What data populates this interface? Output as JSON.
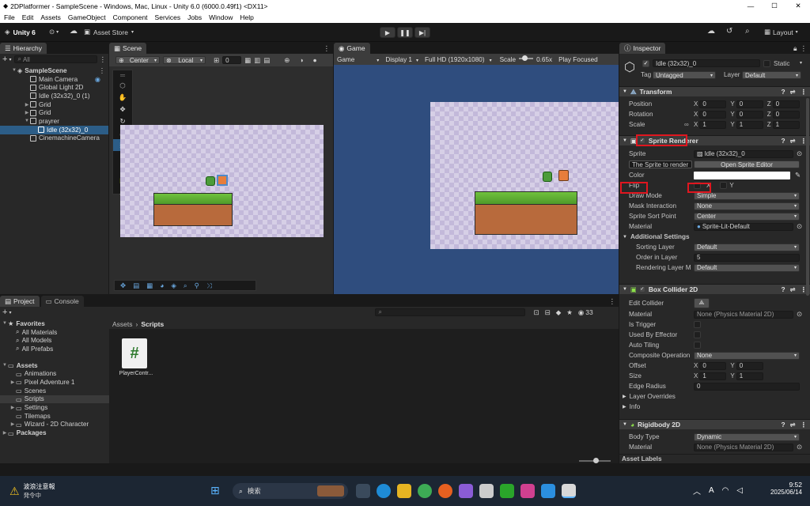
{
  "window": {
    "title": "2DPlatformer - SampleScene - Windows, Mac, Linux - Unity 6.0 (6000.0.49f1) <DX11>",
    "controls": [
      "—",
      "☐",
      "✕"
    ]
  },
  "menu": [
    "File",
    "Edit",
    "Assets",
    "GameObject",
    "Component",
    "Services",
    "Jobs",
    "Window",
    "Help"
  ],
  "toolbar": {
    "account": "Unity 6",
    "asset_store": "Asset Store",
    "layout": "Layout"
  },
  "hierarchy": {
    "tab": "Hierarchy",
    "search_placeholder": "All",
    "scene": "SampleScene",
    "items": [
      "Main Camera",
      "Global Light 2D",
      "Idle (32x32)_0 (1)",
      "Grid",
      "Grid",
      "prayrer",
      "Idle (32x32)_0",
      "CinemachineCamera"
    ]
  },
  "scene_view": {
    "tab": "Scene",
    "pivot": "Center",
    "space": "Local",
    "grid_value": "0"
  },
  "game_view": {
    "tab": "Game",
    "mode": "Game",
    "display": "Display 1",
    "resolution": "Full HD (1920x1080)",
    "scale_label": "Scale",
    "scale_value": "0.65x",
    "play_focused": "Play Focused"
  },
  "inspector": {
    "tab": "Inspector",
    "object_name": "Idle (32x32)_0",
    "static_label": "Static",
    "tag_label": "Tag",
    "tag_value": "Untagged",
    "layer_label": "Layer",
    "layer_value": "Default",
    "transform": {
      "title": "Transform",
      "position_label": "Position",
      "rotation_label": "Rotation",
      "scale_label": "Scale",
      "position": [
        "0",
        "0",
        "0"
      ],
      "rotation": [
        "0",
        "0",
        "0"
      ],
      "scale": [
        "1",
        "1",
        "1"
      ]
    },
    "sprite_renderer": {
      "title": "Sprite Renderer",
      "sprite_label": "Sprite",
      "sprite_value": "Idle (32x32)_0",
      "tooltip": "The Sprite to render",
      "open_editor": "Open Sprite Editor",
      "color_label": "Color",
      "flip_label": "Flip",
      "flip_x": "X",
      "flip_y": "Y",
      "draw_mode_label": "Draw Mode",
      "draw_mode_value": "Simple",
      "mask_label": "Mask Interaction",
      "mask_value": "None",
      "sort_point_label": "Sprite Sort Point",
      "sort_point_value": "Center",
      "material_label": "Material",
      "material_value": "Sprite-Lit-Default",
      "additional": "Additional Settings",
      "sorting_layer_label": "Sorting Layer",
      "sorting_layer_value": "Default",
      "order_label": "Order in Layer",
      "order_value": "5",
      "rendering_label": "Rendering Layer M",
      "rendering_value": "Default"
    },
    "box_collider": {
      "title": "Box Collider 2D",
      "edit_collider": "Edit Collider",
      "material_label": "Material",
      "material_value": "None (Physics Material 2D)",
      "is_trigger": "Is Trigger",
      "used_by_effector": "Used By Effector",
      "auto_tiling": "Auto Tiling",
      "composite_label": "Composite Operation",
      "composite_value": "None",
      "offset_label": "Offset",
      "offset": [
        "0",
        "0"
      ],
      "size_label": "Size",
      "size": [
        "1",
        "1"
      ],
      "edge_label": "Edge Radius",
      "edge_value": "0",
      "layer_overrides": "Layer Overrides",
      "info": "Info"
    },
    "rigidbody": {
      "title": "Rigidbody 2D",
      "body_type_label": "Body Type",
      "body_type_value": "Dynamic",
      "material_label": "Material",
      "material_value": "None (Physics Material 2D)"
    },
    "asset_labels": "Asset Labels"
  },
  "project": {
    "tab": "Project",
    "console_tab": "Console",
    "favorites": "Favorites",
    "fav_items": [
      "All Materials",
      "All Models",
      "All Prefabs"
    ],
    "assets": "Assets",
    "asset_items": [
      "Animations",
      "Pixel Adventure 1",
      "Scenes",
      "Scripts",
      "Settings",
      "Tilemaps",
      "Wizard - 2D Character"
    ],
    "packages": "Packages",
    "breadcrumb_root": "Assets",
    "breadcrumb_leaf": "Scripts",
    "file_name": "PlayerContr...",
    "count": "33"
  },
  "taskbar": {
    "weather_title": "波浪注意報",
    "weather_sub": "発令中",
    "search": "検索",
    "time": "9:52",
    "date": "2025/06/14",
    "lang": "A"
  },
  "colors": {
    "accent_blue": "#2c5d87",
    "highlight_red": "#e0161f",
    "game_bg": "#2f4d7e"
  }
}
